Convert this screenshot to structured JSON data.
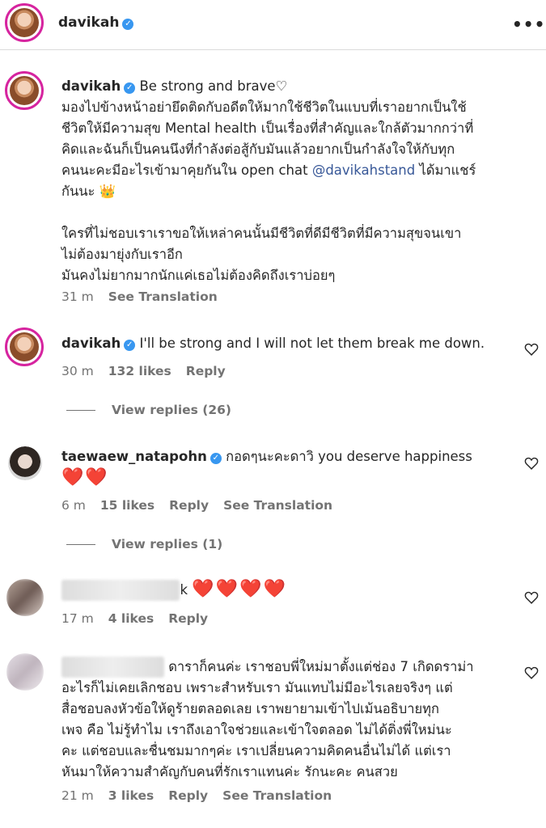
{
  "post": {
    "username": "davikah"
  },
  "caption": {
    "username": "davikah",
    "line1": "Be strong and brave♡",
    "line2": "มองไปข้างหน้าอย่ายึดติดกับอดีตให้มากใช้ชีวิตในแบบที่เราอยากเป็นใช้",
    "line3": "ชีวิตให้มีความสุข Mental health เป็นเรื่องที่สำคัญและใกล้ตัวมากกว่าที่",
    "line4": "คิดและฉันก็เป็นคนนึงที่กำลังต่อสู้กับมันแล้วอยากเป็นกำลังใจให้กับทุก",
    "line5a": "คนนะคะมีอะไรเข้ามาคุยกันใน open chat ",
    "mention": "@davikahstand",
    "line5b": " ได้มาแชร์",
    "line6": "กันนะ 👑",
    "line7": "ใครที่ไม่ชอบเราเราขอให้เหล่าคนนั้นมีชีวิตที่ดีมีชีวิตที่มีความสุขจนเขา",
    "line8": "ไม่ต้องมายุ่งกับเราอีก",
    "line9": "มันคงไม่ยากมากนักแค่เธอไม่ต้องคิดถึงเราบ่อยๆ",
    "time": "31 m",
    "see_translation": "See Translation"
  },
  "comments": [
    {
      "username": "davikah",
      "text": "I'll be strong and I will not let them break me down.",
      "time": "30 m",
      "likes": "132 likes",
      "reply": "Reply",
      "view_replies": "View replies (26)"
    },
    {
      "username": "taewaew_natapohn",
      "text": "กอดๆนะคะดาวิ you deserve happiness",
      "text2": "❤️❤️",
      "time": "6 m",
      "likes": "15 likes",
      "reply": "Reply",
      "see_translation": "See Translation",
      "view_replies": "View replies (1)"
    },
    {
      "username_tail": "k",
      "text": "❤️❤️❤️❤️",
      "time": "17 m",
      "likes": "4 likes",
      "reply": "Reply"
    },
    {
      "text1": "ดาราก็คนค่ะ เราชอบพี่ใหม่มาตั้งแต่ช่อง 7 เกิดดราม่า",
      "text2": "อะไรก็ไม่เคยเลิกชอบ เพราะสำหรับเรา มันแทบไม่มีอะไรเลยจริงๆ แต่",
      "text3": "สื่อชอบลงหัวข้อให้ดูร้ายตลอดเลย เราพยายามเข้าไปเม้นอธิบายทุก",
      "text4": "เพจ คือ ไม่รู้ทำไม เราถึงเอาใจช่วยและเข้าใจตลอด ไม่ได้ติ่งพี่ใหม่นะ",
      "text5": "คะ แต่ชอบและชื่นชมมากๆค่ะ เราเปลี่ยนความคิดคนอื่นไม่ได้ แต่เรา",
      "text6": "หันมาให้ความสำคัญกับคนที่รักเราแทนค่ะ รักนะคะ คนสวย",
      "time": "21 m",
      "likes": "3 likes",
      "reply": "Reply",
      "see_translation": "See Translation"
    }
  ]
}
